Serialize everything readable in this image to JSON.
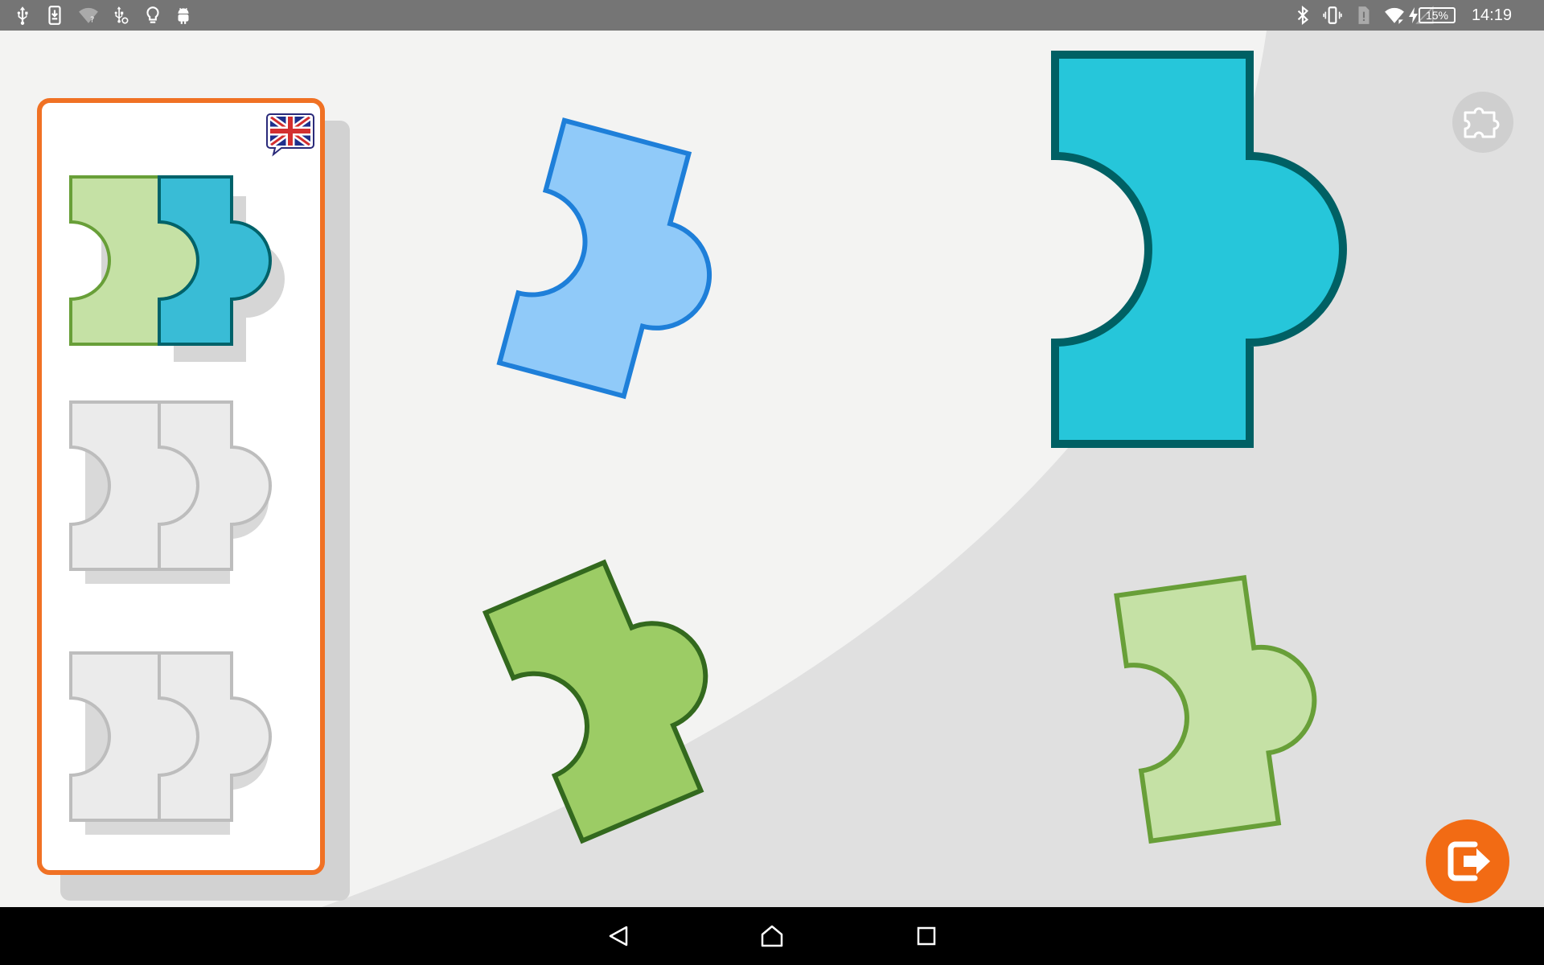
{
  "status_bar": {
    "time": "14:19",
    "battery_level": "15%",
    "left_icons": [
      "usb-icon",
      "download-icon",
      "wifi-unknown-icon",
      "usb-debug-icon",
      "lightbulb-icon",
      "android-icon"
    ],
    "right_icons": [
      "bluetooth-icon",
      "vibrate-icon",
      "sim-missing-icon",
      "wifi-icon",
      "no-signal-icon",
      "charging-icon"
    ]
  },
  "puzzle_card": {
    "language_flag": "uk-flag-icon",
    "slots": [
      {
        "state": "completed",
        "pieces": [
          "light-green",
          "teal"
        ]
      },
      {
        "state": "empty"
      },
      {
        "state": "empty"
      }
    ]
  },
  "pieces": [
    {
      "id": "blue",
      "fill": "#90CAF9",
      "stroke": "#1E7FD9"
    },
    {
      "id": "teal-large",
      "fill": "#26C6DA",
      "stroke": "#006064"
    },
    {
      "id": "green",
      "fill": "#9CCC65",
      "stroke": "#33691E"
    },
    {
      "id": "light-green",
      "fill": "#C5E1A5",
      "stroke": "#689F38"
    }
  ],
  "buttons": {
    "puzzle": "puzzle-icon",
    "exit": "exit-icon"
  },
  "nav_bar": [
    "back-icon",
    "home-icon",
    "recents-icon"
  ],
  "colors": {
    "accent": "#F07124",
    "background_light": "#F3F3F2",
    "background_dark": "#E0E0E0"
  }
}
